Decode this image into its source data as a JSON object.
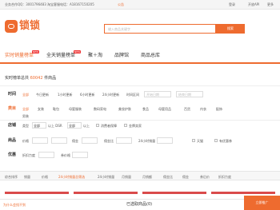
{
  "topbar": {
    "contact": "业务合作QQ：3001796483   淘宝客服电话：A18167150205",
    "notice": "公告",
    "login": "登录",
    "open_api": "开放API",
    "more": "更多"
  },
  "brand": {
    "logo_text": "锁锁",
    "search_placeholder": "输入商品关键字",
    "search_button": "搜索"
  },
  "nav": {
    "items": [
      {
        "label": "实时销量榜单",
        "badge": "NEW"
      },
      {
        "label": "全天销量榜单",
        "badge": "NEW"
      },
      {
        "label": "聚＋淘",
        "badge": ""
      },
      {
        "label": "品牌馆",
        "badge": ""
      },
      {
        "label": "商品总库",
        "badge": ""
      }
    ]
  },
  "result": {
    "prefix": "实时榜单总共",
    "count": "60042",
    "suffix": "件商品"
  },
  "filters": {
    "time": {
      "label": "时间",
      "options": [
        "全部",
        "今日更新",
        "1小时更新",
        "6小时更新",
        "24小时更新",
        "时间区间"
      ],
      "from_placeholder": "开始日期",
      "to_placeholder": "结束日期"
    },
    "category": {
      "label": "类目",
      "row1": [
        "全部",
        "女装",
        "鞋包",
        "母婴服装",
        "数码家电",
        "美妆护肤",
        "食品",
        "母婴用品",
        "百货",
        "内衣",
        "配饰"
      ],
      "row2": [
        "男装"
      ]
    },
    "shop": {
      "label": "店铺",
      "type_label": "类型",
      "type_value": "全部",
      "dsr_label": "以上 DSR",
      "dsr_value": "全部",
      "dsr_suffix": "以上",
      "option_tmall": "消费者保障",
      "option_gold": "金牌卖家"
    },
    "price": {
      "label": "商品",
      "price_label": "价格",
      "commission_label": "佣金",
      "ratio_label": "佣金比",
      "sales_label": "24小时销量",
      "free_shipping": "天猫",
      "coupon": "有优惠券"
    },
    "coupon": {
      "label": "优惠",
      "discount_label": "折扣力度",
      "coupon_amount_label": "券价格"
    }
  },
  "sort": {
    "tabs": [
      "综合排序",
      "销量",
      "价格",
      "24小时销量总筛选",
      "24小时销量",
      "月销量",
      "月销额",
      "佣金比",
      "佣金",
      "券后价",
      "折扣力度"
    ],
    "selected_index": 3
  },
  "bottom": {
    "selected_label": "已选取商品(0)",
    "bulk_button": "立即推广",
    "help_link": "为什么会找不到"
  },
  "colors": {
    "accent": "#ee6b2f",
    "badge": "#ee3333"
  }
}
